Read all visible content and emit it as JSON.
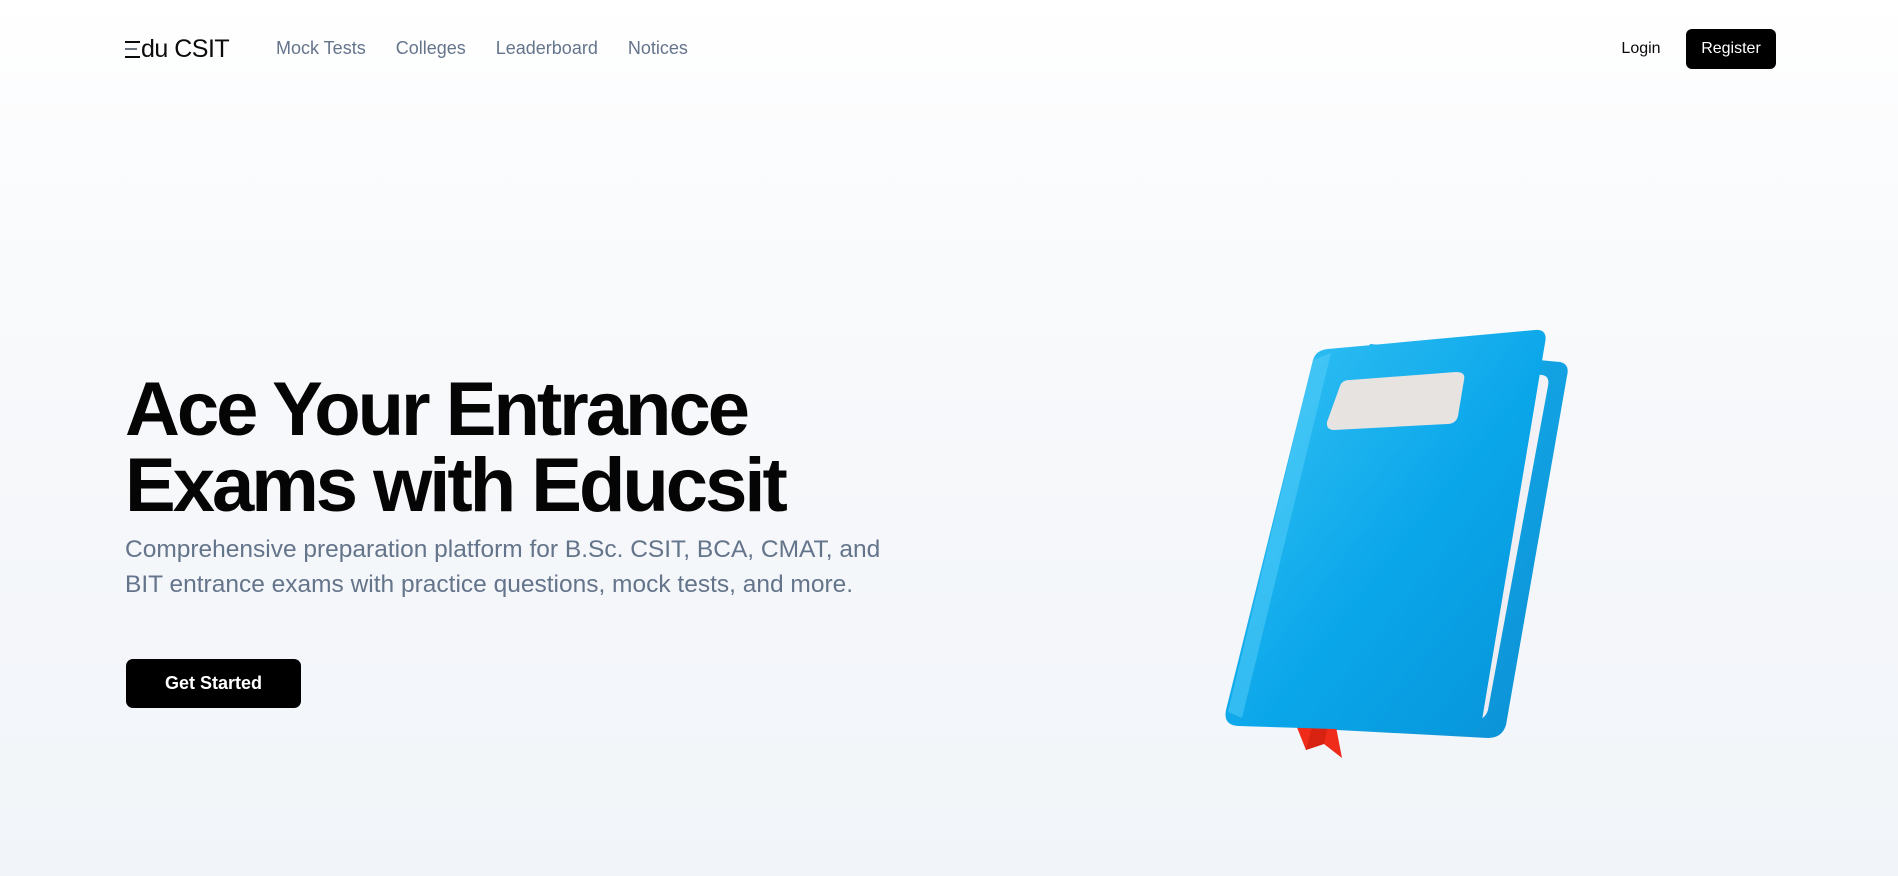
{
  "nav": {
    "brand_main": "du CSIT",
    "links": [
      "Mock Tests",
      "Colleges",
      "Leaderboard",
      "Notices"
    ],
    "login_label": "Login",
    "register_label": "Register"
  },
  "hero": {
    "title_line1": "Ace Your Entrance",
    "title_line2": "Exams with Educsit",
    "description": "Comprehensive preparation platform for B.Sc. CSIT, BCA, CMAT, and BIT entrance exams with practice questions, mock tests, and more.",
    "cta_label": "Get Started",
    "illustration": "blue-book-icon"
  },
  "colors": {
    "accent": "#000000",
    "muted_text": "#64748b",
    "book_blue": "#0ea5e9",
    "bookmark_red": "#ef2b1a"
  }
}
